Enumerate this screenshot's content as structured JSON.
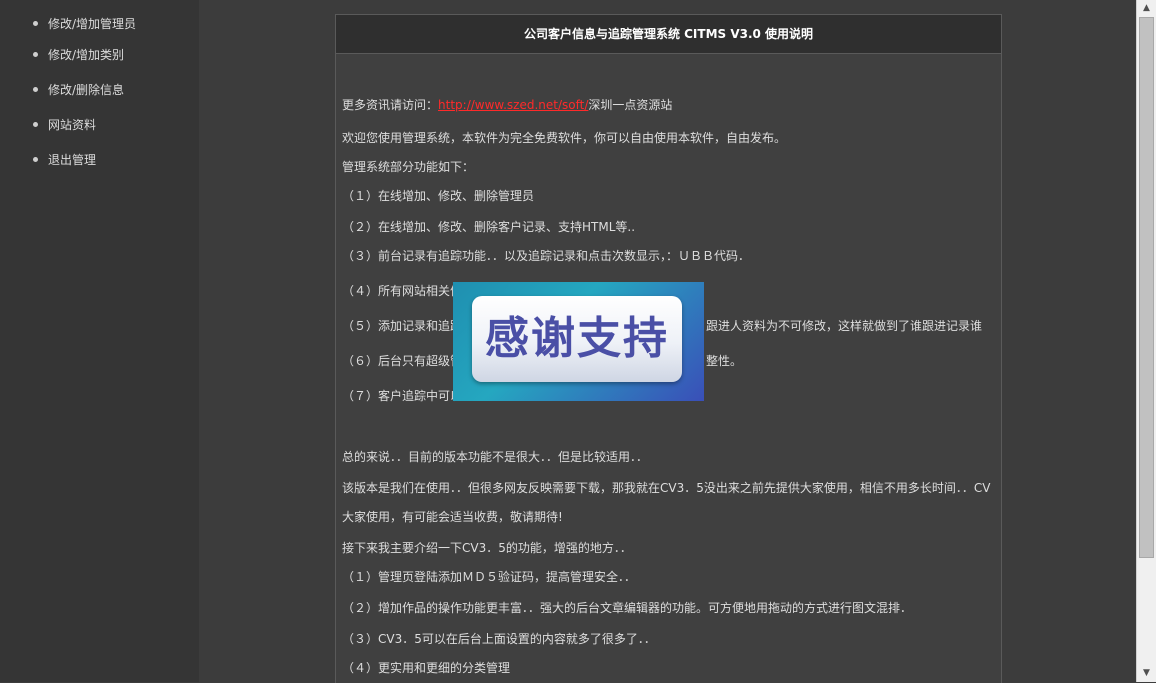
{
  "sidebar": {
    "items": [
      {
        "label": "修改/增加管理员"
      },
      {
        "label": "修改/增加类别"
      },
      {
        "label": "修改/删除信息"
      },
      {
        "label": "网站资料"
      },
      {
        "label": "退出管理"
      }
    ]
  },
  "panel": {
    "title": "公司客户信息与追踪管理系统  CITMS V3.0 使用说明",
    "intro_prefix": "更多资讯请访问：",
    "intro_link": "http://www.szed.net/soft/",
    "intro_suffix": "深圳一点资源站",
    "lines": [
      "欢迎您使用管理系统，本软件为完全免费软件，你可以自由使用本软件，自由发布。",
      "管理系统部分功能如下：",
      "（１）在线增加、修改、删除管理员",
      "（２）在线增加、修改、删除客户记录、支持HTML等..",
      "（３）前台记录有追踪功能．．以及追踪记录和点击次数显示，：ＵＢＢ代码．",
      "（４）所有网站相关信",
      "（５）添加记录和追踪",
      "（６）后台只有超级管",
      "（７）客户追踪中可以",
      " 总的来说．．目前的版本功能不是很大．．但是比较适用．．",
      "该版本是我们在使用．．但很多网友反映需要下载，那我就在CV3．5没出来之前先提供大家使用，相信不用多长时间．．CV",
      "大家使用，有可能会适当收费，敬请期待!",
      "接下来我主要介绍一下CV3．5的功能，增强的地方．．",
      "（１）管理页登陆添加ＭＤ５验证码，提高管理安全．．",
      "（２）增加作品的操作功能更丰富．．强大的后台文章编辑器的功能。可方便地用拖动的方式进行图文混排．",
      "（３）CV3．5可以在后台上面设置的内容就多了很多了．．",
      "（４）更实用和更细的分类管理"
    ],
    "line5_tail": "跟进人资料为不可修改，这样就做到了谁跟进记录谁",
    "line6_tail": "整性。"
  },
  "overlay": {
    "text": "感谢支持"
  },
  "colors": {
    "link": "#ff2a2a",
    "sidebar_bg": "#353535",
    "main_bg": "#3c3c3c",
    "header_bg": "#2f2f2f"
  }
}
